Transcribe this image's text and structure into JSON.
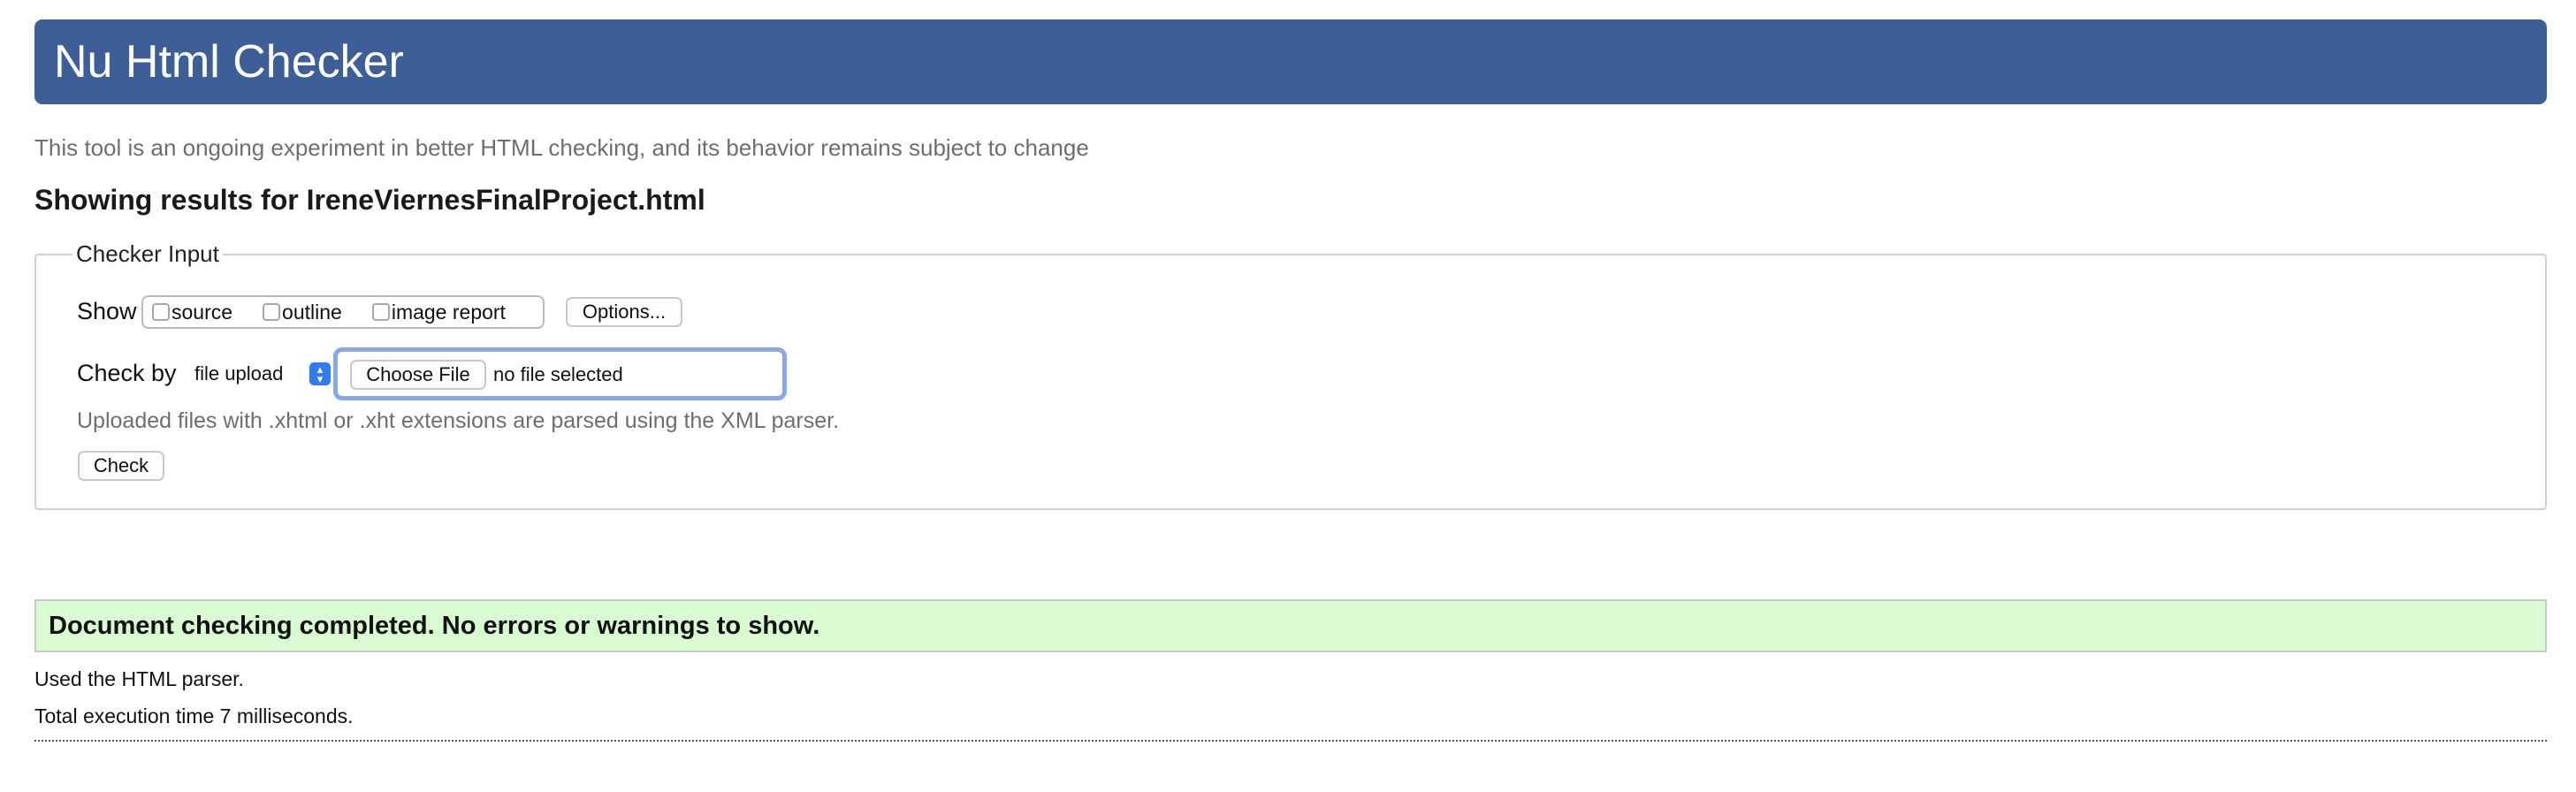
{
  "header": {
    "title": "Nu Html Checker"
  },
  "tagline": "This tool is an ongoing experiment in better HTML checking, and its behavior remains subject to change",
  "results_title": "Showing results for IreneViernesFinalProject.html",
  "checker_input": {
    "legend": "Checker Input",
    "show_label": "Show",
    "show_options": [
      {
        "label": "source",
        "checked": false
      },
      {
        "label": "outline",
        "checked": false
      },
      {
        "label": "image report",
        "checked": false
      }
    ],
    "options_button": "Options...",
    "check_by_label": "Check by",
    "check_by_selected": "file upload",
    "choose_file_button": "Choose File",
    "file_status": "no file selected",
    "parser_note": "Uploaded files with .xhtml or .xht extensions are parsed using the XML parser.",
    "check_button": "Check"
  },
  "result": {
    "message": "Document checking completed. No errors or warnings to show.",
    "parser_used": "Used the HTML parser.",
    "execution_time": "Total execution time 7 milliseconds."
  },
  "colors": {
    "banner": "#3e5e97",
    "success_bg": "#d8fbd1",
    "focus_ring": "#8aa7e6",
    "select_accent": "#2f7bf0"
  }
}
